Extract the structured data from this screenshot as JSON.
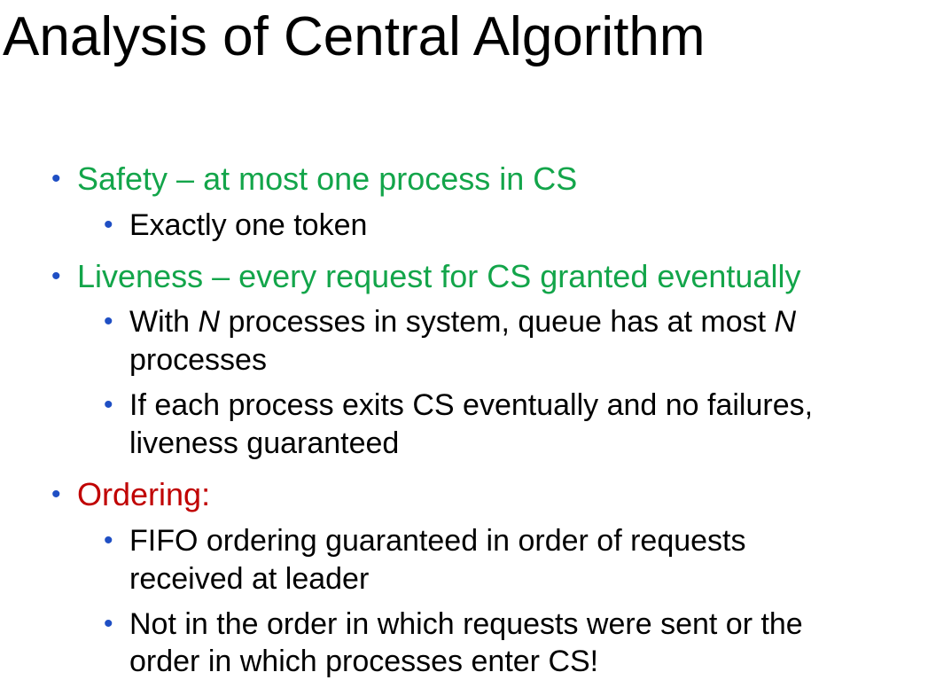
{
  "slide": {
    "title": "Analysis of Central Algorithm",
    "colors": {
      "bullet": "#1f4fc4",
      "safety_liveness": "#13a54a",
      "ordering": "#c00000",
      "body": "#000000"
    },
    "safety": {
      "heading": "Safety – at most one process in CS",
      "sub": [
        "Exactly one token"
      ]
    },
    "liveness": {
      "heading": "Liveness – every request for CS granted eventually",
      "sub1": {
        "a": "With ",
        "n1": "N",
        "b": " processes in system, queue has at most ",
        "n2": "N",
        "c": "processes"
      },
      "sub2": {
        "line1": "If each process exits CS eventually and no failures,",
        "line2": "liveness guaranteed"
      }
    },
    "ordering": {
      "heading": "Ordering:",
      "sub1": {
        "line1": "FIFO ordering guaranteed in order of requests",
        "line2": "received at leader"
      },
      "sub2": {
        "line1": "Not in the order in which requests were sent or the",
        "line2": "order in which processes enter CS!"
      }
    }
  }
}
